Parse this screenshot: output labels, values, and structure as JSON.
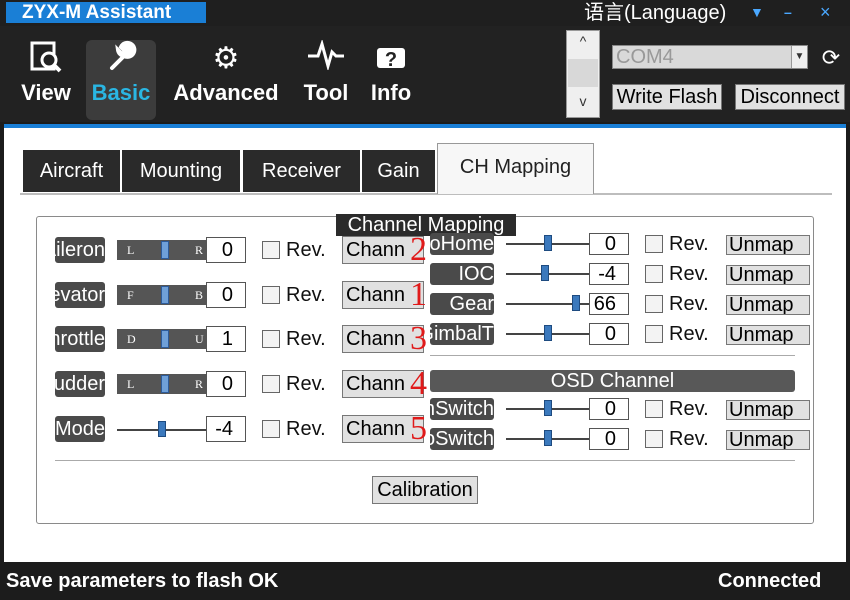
{
  "window": {
    "title": "ZYX-M Assistant",
    "language_label": "语言(Language)",
    "menu_icon": "▼",
    "minimize_icon": "–",
    "close_icon": "×"
  },
  "toolbar": {
    "items": [
      {
        "label": "View",
        "icon": "magnifier-chart-icon",
        "glyph": "🔍",
        "active": false
      },
      {
        "label": "Basic",
        "icon": "wrench-icon",
        "glyph": "🔧",
        "active": true
      },
      {
        "label": "Advanced",
        "icon": "gear-icon",
        "glyph": "⚙",
        "active": false
      },
      {
        "label": "Tool",
        "icon": "pulse-icon",
        "glyph": "⩘",
        "active": false
      },
      {
        "label": "Info",
        "icon": "info-icon",
        "glyph": "ℹ",
        "active": false
      }
    ],
    "scroll_up": "^",
    "scroll_down": "v",
    "com_port": "COM4",
    "combo_arrow": "▼",
    "refresh_glyph": "⟳",
    "write_flash": "Write Flash",
    "disconnect": "Disconnect"
  },
  "tabs": [
    {
      "label": "Aircraft",
      "active": false
    },
    {
      "label": "Mounting",
      "active": false
    },
    {
      "label": "Receiver",
      "active": false
    },
    {
      "label": "Gain",
      "active": false
    },
    {
      "label": "CH Mapping",
      "active": true
    }
  ],
  "channel_mapping": {
    "title": "Channel Mapping",
    "rev_label": "Rev.",
    "chann_label": "Chann",
    "left_rows": [
      {
        "label": "Aileron",
        "lr_left": "L",
        "lr_right": "R",
        "value": "0",
        "channel_number": "2"
      },
      {
        "label": "Elevator",
        "lr_left": "F",
        "lr_right": "B",
        "value": "0",
        "channel_number": "1"
      },
      {
        "label": "Throttle",
        "lr_left": "D",
        "lr_right": "U",
        "value": "1",
        "channel_number": "3"
      },
      {
        "label": "Rudder",
        "lr_left": "L",
        "lr_right": "R",
        "value": "0",
        "channel_number": "4"
      },
      {
        "label": "Mode",
        "value": "-4",
        "channel_number": "5"
      }
    ],
    "right_rows": [
      {
        "label": "AutoHome",
        "value": "0",
        "unmap": "Unmap",
        "slider_level": 0.5
      },
      {
        "label": "IOC",
        "value": "-4",
        "unmap": "Unmap",
        "slider_level": 0.47
      },
      {
        "label": "Gear",
        "value": "66",
        "unmap": "Unmap",
        "slider_level": 0.83
      },
      {
        "label": "GimbalT",
        "value": "0",
        "unmap": "Unmap",
        "slider_level": 0.5
      }
    ],
    "osd_title": "OSD Channel",
    "osd_rows": [
      {
        "label": "CamSwitch",
        "value": "0",
        "unmap": "Unmap",
        "slider_level": 0.5
      },
      {
        "label": "VidoSwitch",
        "value": "0",
        "unmap": "Unmap",
        "slider_level": 0.5
      }
    ],
    "mode_slider_level": 0.5,
    "calibration": "Calibration"
  },
  "status": {
    "message": "Save parameters to flash OK",
    "connection": "Connected"
  }
}
